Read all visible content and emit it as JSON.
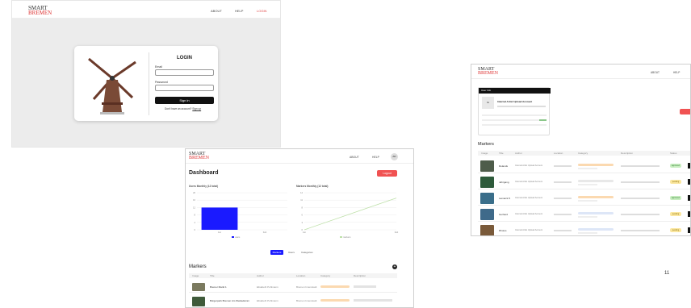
{
  "slide1": {
    "logo_line1": "SMART",
    "logo_line2": "BREMEN",
    "nav": {
      "about": "ABOUT",
      "help": "HELP",
      "login": "LOGIN"
    },
    "card": {
      "title": "LOGIN",
      "email_label": "Email",
      "password_label": "Password",
      "signin_label": "Sign in",
      "signup_text": "Don't have an account?",
      "signup_link": "Sign up"
    }
  },
  "slide2": {
    "logo_line1": "SMART",
    "logo_line2": "BREMEN",
    "nav": {
      "about": "ABOUT",
      "help": "HELP",
      "avatar": "AD"
    },
    "title": "Dashboard",
    "logout_label": "Logout",
    "users_chart_title": "Users Monthly (12 total)",
    "markers_chart_title": "Markers Monthly (12 total)",
    "tabs": [
      "Markers",
      "Users",
      "Categories"
    ],
    "markers_title": "Markers",
    "table_headers": [
      "Image",
      "Title",
      "Author",
      "Location",
      "Category",
      "Description"
    ],
    "rows": [
      {
        "title": "Bremer Markt 1",
        "author": "Elisabeth Pohlmann",
        "location": "Bremen Innenstadt"
      },
      {
        "title": "Bürgerpark Bremen Am Weidedamm",
        "author": "Elisabeth Pohlmann",
        "location": "Bremen Innenstadt"
      }
    ]
  },
  "slide3": {
    "logo_line1": "SMART",
    "logo_line2": "BREMEN",
    "nav": {
      "about": "ABOUT",
      "help": "HELP"
    },
    "user_info_title": "User Info",
    "user_name": "Internal Artist Upload Account",
    "markers_title": "Markers",
    "table_headers": [
      "Image",
      "Title",
      "Author",
      "Location",
      "Category",
      "Description",
      "Status"
    ],
    "rows": [
      {
        "title": "Rolands",
        "author": "Internal Artist Upload Account",
        "status": "approved"
      },
      {
        "title": "Jahrgang",
        "author": "Internal Artist Upload Account",
        "status": "pending"
      },
      {
        "title": "Lamarck 5",
        "author": "Internal Artist Upload Account",
        "status": "approved"
      },
      {
        "title": "Gerhard",
        "author": "Internal Artist Upload Account",
        "status": "pending"
      },
      {
        "title": "Rhotus",
        "author": "Internal Artist Upload Account",
        "status": "pending"
      }
    ]
  },
  "page_number": "11",
  "chart_data": [
    {
      "type": "bar",
      "title": "Users Monthly (12 total)",
      "categories": [
        "Jun",
        "Feb"
      ],
      "series": [
        {
          "name": "users",
          "values": [
            12,
            0
          ]
        }
      ],
      "ylim": [
        0,
        20
      ],
      "color": "#1a1aff"
    },
    {
      "type": "line",
      "title": "Markers Monthly (12 total)",
      "categories": [
        "Jun",
        "Feb"
      ],
      "series": [
        {
          "name": "markers",
          "values": [
            0,
            12
          ]
        }
      ],
      "ylim": [
        0,
        14
      ],
      "color": "#bde0a8"
    }
  ],
  "colors": {
    "accent_red": "#e04848",
    "brand_blue": "#1a1aff",
    "dark": "#111111"
  }
}
